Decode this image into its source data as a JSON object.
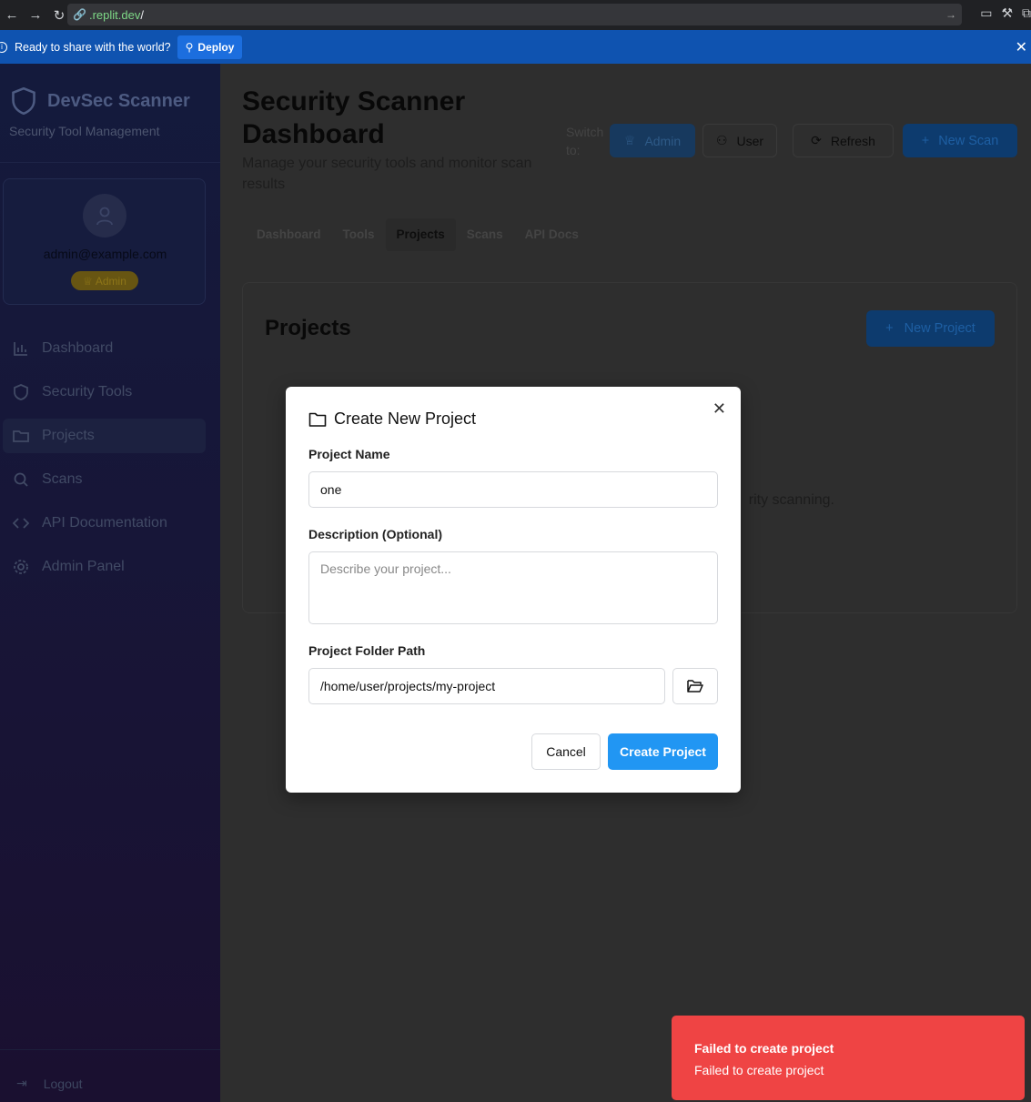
{
  "browser": {
    "url_host": ".replit.dev",
    "url_path": "/"
  },
  "deploy_bar": {
    "message": "Ready to share with the world?",
    "deploy_label": "Deploy"
  },
  "sidebar": {
    "brand_title": "DevSec Scanner",
    "brand_subtitle": "Security Tool Management",
    "user": {
      "email": "admin@example.com",
      "role": "Admin"
    },
    "items": [
      {
        "label": "Dashboard",
        "icon": "bar-chart-icon"
      },
      {
        "label": "Security Tools",
        "icon": "shield-icon"
      },
      {
        "label": "Projects",
        "icon": "folder-icon",
        "active": true
      },
      {
        "label": "Scans",
        "icon": "search-icon"
      },
      {
        "label": "API Documentation",
        "icon": "code-icon"
      },
      {
        "label": "Admin Panel",
        "icon": "gear-icon"
      }
    ],
    "logout_label": "Logout"
  },
  "header": {
    "title": "Security Scanner Dashboard",
    "subtitle": "Manage your security tools and monitor scan results",
    "switch_label": "Switch to:",
    "admin_label": "Admin",
    "user_label": "User",
    "refresh_label": "Refresh",
    "new_scan_label": "New Scan"
  },
  "tabs": [
    "Dashboard",
    "Tools",
    "Projects",
    "Scans",
    "API Docs"
  ],
  "active_tab": "Projects",
  "projects_card": {
    "title": "Projects",
    "new_project_label": "New Project",
    "empty_text_fragment": "rity scanning."
  },
  "modal": {
    "title": "Create New Project",
    "name_label": "Project Name",
    "name_value": "one",
    "description_label": "Description (Optional)",
    "description_placeholder": "Describe your project...",
    "path_label": "Project Folder Path",
    "path_value": "/home/user/projects/my-project",
    "cancel_label": "Cancel",
    "create_label": "Create Project"
  },
  "toast": {
    "title": "Failed to create project",
    "description": "Failed to create project",
    "color": "#ef4444"
  },
  "colors": {
    "primary": "#2196f3",
    "deploy_bar": "#0f53b0",
    "sidebar": "#141a3c"
  }
}
